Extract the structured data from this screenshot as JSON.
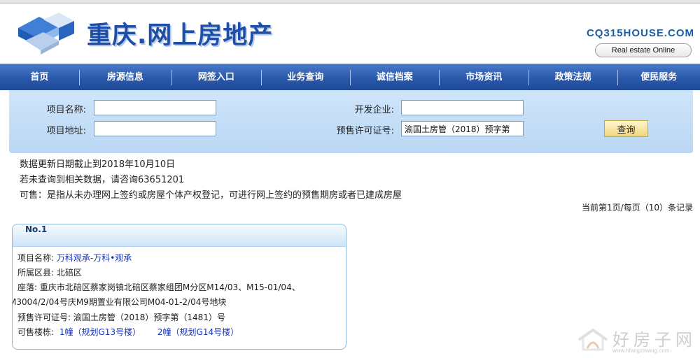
{
  "header": {
    "title": "重庆.网上房地产",
    "domain": "CQ315HOUSE.COM",
    "tagline": "Real estate Online"
  },
  "nav": {
    "items": [
      {
        "label": "首页"
      },
      {
        "label": "房源信息"
      },
      {
        "label": "网签入口"
      },
      {
        "label": "业务查询"
      },
      {
        "label": "诚信档案"
      },
      {
        "label": "市场资讯"
      },
      {
        "label": "政策法规"
      },
      {
        "label": "便民服务"
      }
    ]
  },
  "search": {
    "project_name_label": "项目名称:",
    "project_name_value": "",
    "developer_label": "开发企业:",
    "developer_value": "",
    "project_address_label": "项目地址:",
    "project_address_value": "",
    "permit_label": "预售许可证号:",
    "permit_value": "渝国土房管（2018）预字第",
    "query_button": "查询"
  },
  "notes": {
    "line1": "数据更新日期截止到2018年10月10日",
    "line2": "若未查询到相关数据，请咨询63651201",
    "line3": "可售：是指从未办理网上签约或房屋个体产权登记，可进行网上签约的预售期房或者已建成房屋",
    "pager": "当前第1页/每页（10）条记录"
  },
  "result": {
    "number": "No.1",
    "project_name_label": "项目名称:",
    "project_name_value": "万科观承-万科•观承",
    "district_label": "所属区县:",
    "district_value": "北碚区",
    "location_label": "座落:",
    "location_value_1": "重庆市北碚区蔡家岗镇北碚区蔡家组团M分区M14/03、M15-01/04、",
    "location_value_2": "M3004/2/04号庆M9期置业有限公司M04-01-2/04号地块",
    "permit_label": "预售许可证号:",
    "permit_value": "渝国土房管（2018）预字第（1481）号",
    "buildings_label": "可售楼栋:",
    "buildings": [
      "1幢（规划G13号楼）",
      "2幢（规划G14号楼）"
    ]
  },
  "watermark": {
    "text": "好房子网",
    "url": "www.hfangziwang.com"
  },
  "colors": {
    "nav": "#2a58aa",
    "title": "#1e4fa8",
    "panel": "#c6e0f8",
    "link": "#1733b8"
  }
}
